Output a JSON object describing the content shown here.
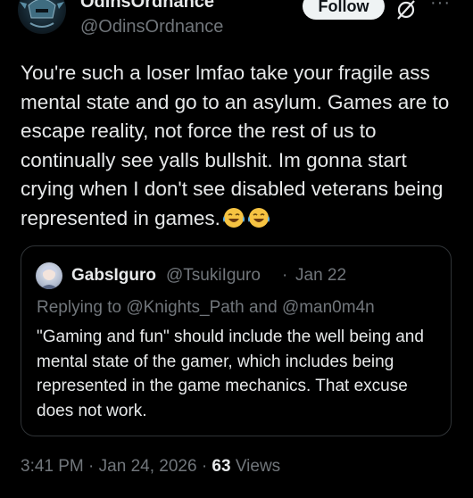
{
  "author": {
    "display_name": "OdinsOrdnance",
    "handle": "@OdinsOrdnance",
    "follow_label": "Follow",
    "more_label": "···"
  },
  "tweet": {
    "text": "You're such a loser lmfao take your fragile ass mental state and go to an asylum. Games are to escape reality, not force the rest of us to continually see yalls bullshit. Im gonna start crying when I don't see disabled veterans being represented in games."
  },
  "quoted": {
    "display_name": "GabsIguro",
    "handle": "@TsukiIguro",
    "dot": "·",
    "date": "Jan 22",
    "replying_prefix": "Replying to",
    "mention_1": "@Knights_Path",
    "and_word": "and",
    "mention_2": "@man0m4n",
    "text": "\"Gaming and fun\" should include the well being and mental state of the gamer, which includes being represented in the game mechanics. That excuse does not work."
  },
  "meta": {
    "time": "3:41 PM",
    "sep1": "·",
    "date": "Jan 24, 2026",
    "sep2": "·",
    "views_count": "63",
    "views_label": "Views"
  },
  "colors": {
    "background": "#000000",
    "text_primary": "#e7e9ea",
    "text_secondary": "#71767b",
    "border": "#2f3336",
    "follow_bg": "#eff3f4"
  },
  "icons": [
    "avatar",
    "grok-icon",
    "more-icon",
    "laughing-crying-emoji"
  ]
}
